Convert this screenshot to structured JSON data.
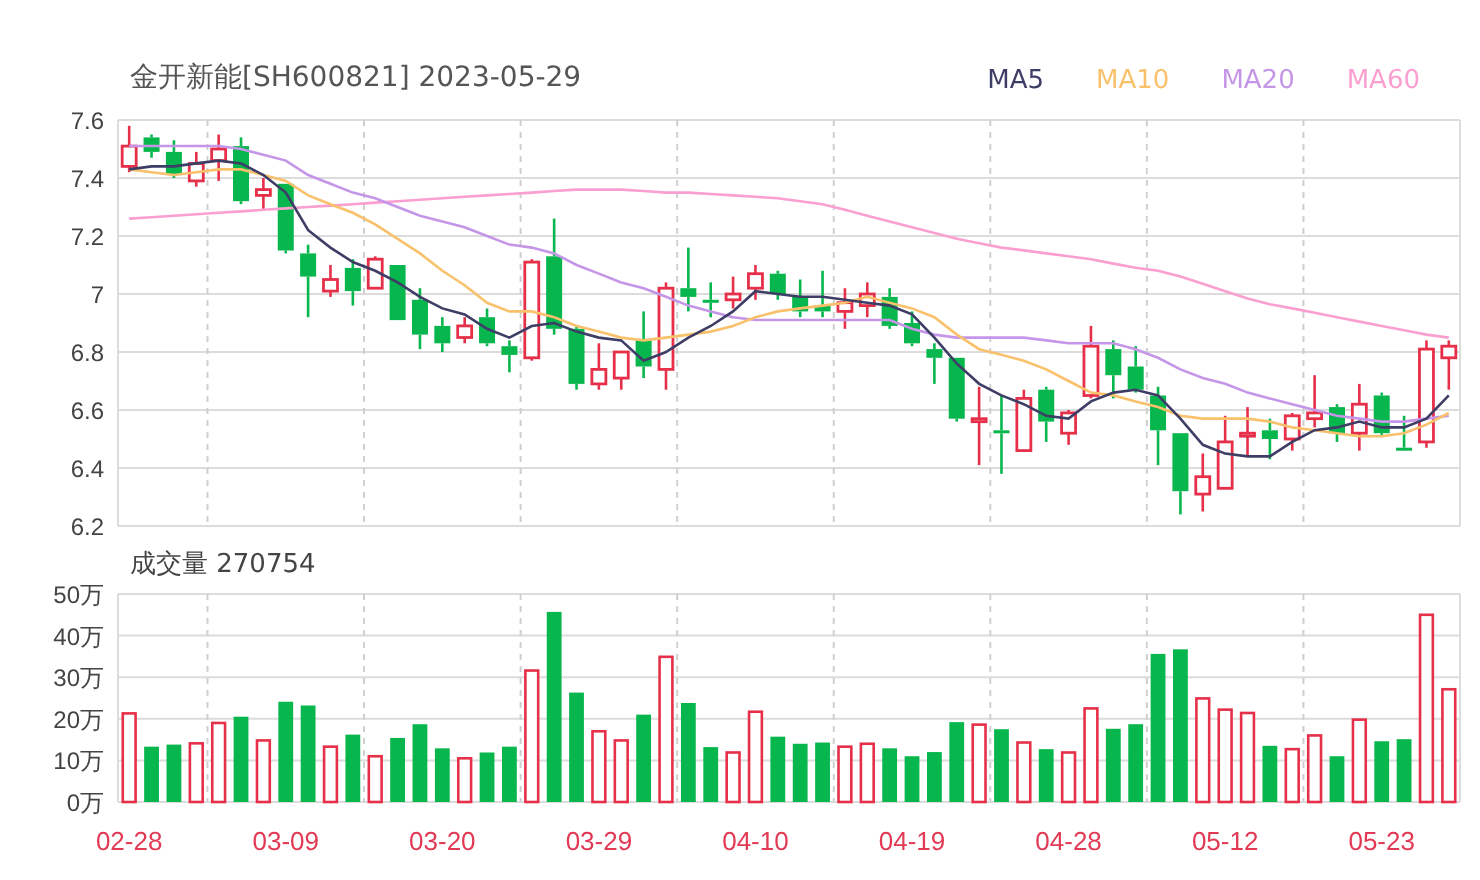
{
  "header": {
    "title": "金开新能[SH600821] 2023-05-29"
  },
  "price_chart": {
    "chart_data": {
      "type": "candlestick",
      "grid": true,
      "ylim": [
        6.2,
        7.6
      ],
      "yticks": [
        {
          "value": 7.6,
          "label": "7.6"
        },
        {
          "value": 7.4,
          "label": "7.4"
        },
        {
          "value": 7.2,
          "label": "7.2"
        },
        {
          "value": 7.0,
          "label": "7"
        },
        {
          "value": 6.8,
          "label": "6.8"
        },
        {
          "value": 6.6,
          "label": "6.6"
        },
        {
          "value": 6.4,
          "label": "6.4"
        },
        {
          "value": 6.2,
          "label": "6.2"
        }
      ],
      "categories": [
        null,
        null,
        null,
        null,
        null,
        null,
        null,
        null,
        null,
        null,
        null,
        null,
        null,
        null,
        null,
        null,
        null,
        null,
        null,
        null,
        null,
        null,
        null,
        null,
        null,
        null,
        null,
        null,
        null,
        null,
        null,
        null,
        null,
        null,
        null,
        null,
        null,
        null,
        null,
        null,
        null,
        null,
        null,
        null,
        null,
        null,
        null,
        null,
        null,
        null,
        null,
        null,
        null,
        null,
        null,
        null,
        null,
        null,
        null,
        null
      ],
      "ohlc": [
        [
          7.44,
          7.58,
          7.42,
          7.51
        ],
        [
          7.54,
          7.55,
          7.47,
          7.49
        ],
        [
          7.49,
          7.53,
          7.4,
          7.41
        ],
        [
          7.39,
          7.49,
          7.37,
          7.45
        ],
        [
          7.46,
          7.55,
          7.39,
          7.5
        ],
        [
          7.51,
          7.54,
          7.31,
          7.32
        ],
        [
          7.34,
          7.4,
          7.29,
          7.36
        ],
        [
          7.38,
          7.38,
          7.14,
          7.15
        ],
        [
          7.14,
          7.17,
          6.92,
          7.06
        ],
        [
          7.01,
          7.1,
          6.99,
          7.05
        ],
        [
          7.09,
          7.12,
          6.96,
          7.01
        ],
        [
          7.02,
          7.13,
          7.02,
          7.12
        ],
        [
          7.1,
          7.1,
          6.91,
          6.91
        ],
        [
          6.98,
          7.02,
          6.81,
          6.86
        ],
        [
          6.89,
          6.92,
          6.8,
          6.83
        ],
        [
          6.85,
          6.92,
          6.83,
          6.89
        ],
        [
          6.92,
          6.95,
          6.82,
          6.83
        ],
        [
          6.82,
          6.84,
          6.73,
          6.79
        ],
        [
          6.78,
          7.12,
          6.77,
          7.11
        ],
        [
          7.13,
          7.26,
          6.86,
          6.88
        ],
        [
          6.88,
          6.89,
          6.67,
          6.69
        ],
        [
          6.69,
          6.83,
          6.67,
          6.74
        ],
        [
          6.71,
          6.8,
          6.67,
          6.8
        ],
        [
          6.84,
          6.94,
          6.71,
          6.75
        ],
        [
          6.74,
          7.04,
          6.67,
          7.02
        ],
        [
          7.02,
          7.16,
          6.94,
          6.99
        ],
        [
          6.98,
          7.04,
          6.92,
          6.97
        ],
        [
          6.98,
          7.06,
          6.95,
          7.0
        ],
        [
          7.02,
          7.1,
          6.98,
          7.07
        ],
        [
          7.07,
          7.08,
          6.98,
          7.0
        ],
        [
          6.99,
          7.05,
          6.92,
          6.94
        ],
        [
          6.96,
          7.08,
          6.92,
          6.94
        ],
        [
          6.94,
          7.02,
          6.88,
          6.97
        ],
        [
          6.96,
          7.04,
          6.92,
          7.0
        ],
        [
          6.99,
          7.02,
          6.88,
          6.89
        ],
        [
          6.9,
          6.94,
          6.82,
          6.83
        ],
        [
          6.81,
          6.83,
          6.69,
          6.78
        ],
        [
          6.78,
          6.78,
          6.56,
          6.57
        ],
        [
          6.56,
          6.68,
          6.41,
          6.57
        ],
        [
          6.53,
          6.65,
          6.38,
          6.52
        ],
        [
          6.46,
          6.67,
          6.46,
          6.64
        ],
        [
          6.67,
          6.68,
          6.49,
          6.56
        ],
        [
          6.52,
          6.6,
          6.48,
          6.59
        ],
        [
          6.65,
          6.89,
          6.64,
          6.82
        ],
        [
          6.81,
          6.84,
          6.64,
          6.72
        ],
        [
          6.75,
          6.82,
          6.66,
          6.67
        ],
        [
          6.65,
          6.68,
          6.41,
          6.53
        ],
        [
          6.52,
          6.52,
          6.24,
          6.32
        ],
        [
          6.31,
          6.45,
          6.25,
          6.37
        ],
        [
          6.33,
          6.58,
          6.33,
          6.49
        ],
        [
          6.51,
          6.61,
          6.44,
          6.52
        ],
        [
          6.53,
          6.57,
          6.43,
          6.5
        ],
        [
          6.5,
          6.59,
          6.46,
          6.58
        ],
        [
          6.57,
          6.72,
          6.54,
          6.59
        ],
        [
          6.61,
          6.62,
          6.49,
          6.52
        ],
        [
          6.52,
          6.69,
          6.46,
          6.62
        ],
        [
          6.65,
          6.66,
          6.51,
          6.52
        ],
        [
          6.47,
          6.58,
          6.46,
          6.46
        ],
        [
          6.49,
          6.84,
          6.47,
          6.81
        ],
        [
          6.78,
          6.84,
          6.67,
          6.82
        ]
      ],
      "series": [
        {
          "name": "MA5",
          "type": "line",
          "color": "#3d3d66",
          "values": [
            7.43,
            7.44,
            7.44,
            7.45,
            7.46,
            7.45,
            7.41,
            7.35,
            7.22,
            7.16,
            7.11,
            7.08,
            7.04,
            6.99,
            6.95,
            6.93,
            6.88,
            6.85,
            6.89,
            6.9,
            6.87,
            6.85,
            6.84,
            6.77,
            6.8,
            6.85,
            6.89,
            6.94,
            7.01,
            7.0,
            6.99,
            6.99,
            6.98,
            6.97,
            6.96,
            6.93,
            6.85,
            6.76,
            6.69,
            6.65,
            6.62,
            6.58,
            6.57,
            6.63,
            6.66,
            6.67,
            6.65,
            6.57,
            6.48,
            6.45,
            6.44,
            6.44,
            6.49,
            6.53,
            6.54,
            6.56,
            6.54,
            6.54,
            6.57,
            6.65
          ]
        },
        {
          "name": "MA10",
          "type": "line",
          "color": "#f9c16b",
          "values": [
            7.43,
            7.42,
            7.41,
            7.42,
            7.43,
            7.43,
            7.41,
            7.39,
            7.34,
            7.31,
            7.28,
            7.24,
            7.19,
            7.14,
            7.08,
            7.03,
            6.97,
            6.94,
            6.94,
            6.92,
            6.89,
            6.87,
            6.85,
            6.84,
            6.85,
            6.86,
            6.87,
            6.89,
            6.92,
            6.94,
            6.95,
            6.96,
            6.97,
            6.99,
            6.97,
            6.95,
            6.92,
            6.86,
            6.81,
            6.79,
            6.77,
            6.74,
            6.7,
            6.66,
            6.65,
            6.63,
            6.61,
            6.58,
            6.57,
            6.57,
            6.57,
            6.56,
            6.54,
            6.53,
            6.52,
            6.51,
            6.51,
            6.52,
            6.55,
            6.59
          ]
        },
        {
          "name": "MA20",
          "type": "line",
          "color": "#c596e8",
          "values": [
            7.51,
            7.51,
            7.51,
            7.51,
            7.51,
            7.5,
            7.48,
            7.46,
            7.41,
            7.38,
            7.35,
            7.33,
            7.3,
            7.27,
            7.25,
            7.23,
            7.2,
            7.17,
            7.16,
            7.14,
            7.1,
            7.07,
            7.04,
            7.02,
            6.99,
            6.96,
            6.94,
            6.92,
            6.91,
            6.91,
            6.91,
            6.91,
            6.91,
            6.91,
            6.91,
            6.88,
            6.86,
            6.85,
            6.85,
            6.85,
            6.85,
            6.84,
            6.83,
            6.83,
            6.83,
            6.81,
            6.78,
            6.74,
            6.71,
            6.69,
            6.66,
            6.64,
            6.62,
            6.6,
            6.58,
            6.57,
            6.56,
            6.56,
            6.57,
            6.58
          ]
        },
        {
          "name": "MA60",
          "type": "line",
          "color": "#fa9fd0",
          "values": [
            7.26,
            7.265,
            7.27,
            7.275,
            7.28,
            7.285,
            7.29,
            7.295,
            7.3,
            7.305,
            7.31,
            7.315,
            7.32,
            7.325,
            7.33,
            7.335,
            7.34,
            7.345,
            7.35,
            7.355,
            7.36,
            7.36,
            7.36,
            7.355,
            7.35,
            7.35,
            7.345,
            7.34,
            7.335,
            7.33,
            7.32,
            7.31,
            7.29,
            7.27,
            7.25,
            7.23,
            7.21,
            7.19,
            7.175,
            7.16,
            7.15,
            7.14,
            7.13,
            7.12,
            7.105,
            7.09,
            7.08,
            7.06,
            7.035,
            7.01,
            6.985,
            6.965,
            6.95,
            6.935,
            6.92,
            6.905,
            6.89,
            6.875,
            6.86,
            6.85
          ]
        }
      ]
    }
  },
  "volume_panel": {
    "label": "成交量 270754",
    "chart_data": {
      "type": "bar",
      "grid": true,
      "ylim": [
        0,
        50
      ],
      "yticks": [
        {
          "value": 50,
          "label": "50万"
        },
        {
          "value": 40,
          "label": "40万"
        },
        {
          "value": 30,
          "label": "30万"
        },
        {
          "value": 20,
          "label": "20万"
        },
        {
          "value": 10,
          "label": "10万"
        },
        {
          "value": 0,
          "label": "0万"
        }
      ],
      "categories": [
        "02-28",
        null,
        null,
        null,
        null,
        null,
        null,
        "03-09",
        null,
        null,
        null,
        null,
        null,
        null,
        "03-20",
        null,
        null,
        null,
        null,
        null,
        null,
        "03-29",
        null,
        null,
        null,
        null,
        null,
        null,
        "04-10",
        null,
        null,
        null,
        null,
        null,
        null,
        "04-19",
        null,
        null,
        null,
        null,
        null,
        null,
        "04-28",
        null,
        null,
        null,
        null,
        null,
        null,
        "05-12",
        null,
        null,
        null,
        null,
        null,
        null,
        "05-23",
        null,
        null,
        null
      ],
      "series": [
        {
          "values": [
            21.3,
            13.3,
            13.8,
            14.1,
            19.0,
            20.5,
            14.8,
            24.1,
            23.2,
            13.3,
            16.2,
            11.0,
            15.4,
            18.7,
            12.9,
            10.5,
            11.9,
            13.3,
            31.6,
            45.7,
            26.3,
            17.0,
            14.8,
            21.0,
            34.9,
            23.8,
            13.2,
            11.9,
            21.7,
            15.7,
            14.0,
            14.3,
            13.3,
            14.0,
            12.9,
            11.0,
            12.0,
            19.2,
            18.6,
            17.5,
            14.3,
            12.7,
            11.9,
            22.5,
            17.6,
            18.7,
            35.6,
            36.7,
            24.9,
            22.2,
            21.4,
            13.5,
            12.7,
            16.0,
            11.0,
            19.8,
            14.6,
            15.1,
            45.0,
            27.1
          ]
        }
      ]
    }
  }
}
